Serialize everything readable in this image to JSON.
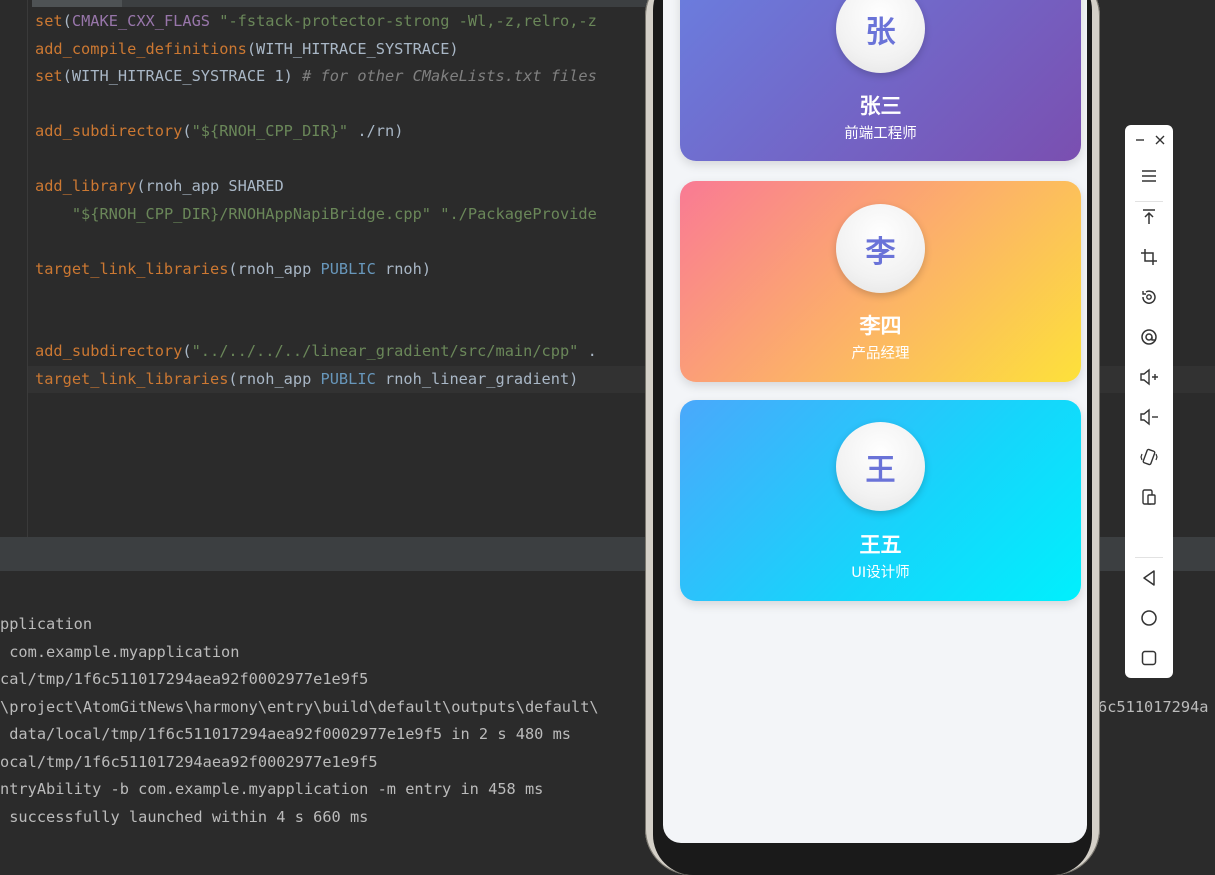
{
  "editor": {
    "lines": [
      [
        {
          "t": "set",
          "c": "fn"
        },
        {
          "t": "(",
          "c": "plain"
        },
        {
          "t": "CMAKE_CXX_FLAGS",
          "c": "var"
        },
        {
          "t": " ",
          "c": "plain"
        },
        {
          "t": "\"-fstack-protector-strong -Wl,-z,relro,-z",
          "c": "str"
        }
      ],
      [
        {
          "t": "add_compile_definitions",
          "c": "fn"
        },
        {
          "t": "(WITH_HITRACE_SYSTRACE)",
          "c": "plain"
        }
      ],
      [
        {
          "t": "set",
          "c": "fn"
        },
        {
          "t": "(WITH_HITRACE_SYSTRACE 1) ",
          "c": "plain"
        },
        {
          "t": "# for other CMakeLists.txt files",
          "c": "cmt"
        }
      ],
      [],
      [
        {
          "t": "add_subdirectory",
          "c": "fn"
        },
        {
          "t": "(",
          "c": "plain"
        },
        {
          "t": "\"${RNOH_CPP_DIR}\"",
          "c": "str"
        },
        {
          "t": " ./rn)",
          "c": "plain"
        }
      ],
      [],
      [
        {
          "t": "add_library",
          "c": "fn"
        },
        {
          "t": "(rnoh_app SHARED",
          "c": "plain"
        }
      ],
      [
        {
          "t": "    ",
          "c": "plain"
        },
        {
          "t": "\"${RNOH_CPP_DIR}/RNOHAppNapiBridge.cpp\"",
          "c": "str"
        },
        {
          "t": " ",
          "c": "plain"
        },
        {
          "t": "\"./PackageProvide",
          "c": "str"
        }
      ],
      [],
      [
        {
          "t": "target_link_libraries",
          "c": "fn"
        },
        {
          "t": "(rnoh_app ",
          "c": "plain"
        },
        {
          "t": "PUBLIC",
          "c": "kw"
        },
        {
          "t": " rnoh)",
          "c": "plain"
        }
      ],
      [],
      [],
      [
        {
          "t": "add_subdirectory",
          "c": "fn"
        },
        {
          "t": "(",
          "c": "plain"
        },
        {
          "t": "\"../../../../linear_gradient/src/main/cpp\"",
          "c": "str"
        },
        {
          "t": " .",
          "c": "plain"
        }
      ],
      [
        {
          "t": "target_link_libraries",
          "c": "fn"
        },
        {
          "t": "(rnoh_app ",
          "c": "plain"
        },
        {
          "t": "PUBLIC",
          "c": "kw"
        },
        {
          "t": " rnoh_linear_gradient)",
          "c": "plain"
        }
      ]
    ]
  },
  "console": {
    "lines": [
      "pplication",
      " com.example.myapplication",
      "cal/tmp/1f6c511017294aea92f0002977e1e9f5",
      "\\project\\AtomGitNews\\harmony\\entry\\build\\default\\outputs\\default\\",
      " data/local/tmp/1f6c511017294aea92f0002977e1e9f5 in 2 s 480 ms",
      "ocal/tmp/1f6c511017294aea92f0002977e1e9f5",
      "ntryAbility -b com.example.myapplication -m entry in 458 ms",
      " successfully launched within 4 s 660 ms"
    ],
    "overflow_text": "6c511017294a"
  },
  "phone": {
    "cards": [
      {
        "initial": "张",
        "name": "张三",
        "role": "前端工程师",
        "gradient": [
          "#6a7fe0",
          "#7a4fb0"
        ]
      },
      {
        "initial": "李",
        "name": "李四",
        "role": "产品经理",
        "gradient": [
          "#f97a94",
          "#fde13a"
        ]
      },
      {
        "initial": "王",
        "name": "王五",
        "role": "UI设计师",
        "gradient": [
          "#4aa8fb",
          "#00f0fd"
        ]
      }
    ]
  },
  "toolbar": {
    "icons": [
      "minimize-icon",
      "close-icon",
      "menu-icon",
      "pin-top-icon",
      "screenshot-crop-icon",
      "rotate-icon",
      "screen-record-icon",
      "volume-up-icon",
      "volume-down-icon",
      "shake-icon",
      "fold-device-icon",
      "back-icon",
      "home-icon",
      "recent-apps-icon"
    ]
  },
  "colors": {
    "editor_bg": "#2b2b2b",
    "keyword_orange": "#cc7832",
    "string_green": "#6a8759",
    "variable_purple": "#9876aa",
    "public_blue": "#6897bb",
    "avatar_text": "#6a73d8"
  }
}
